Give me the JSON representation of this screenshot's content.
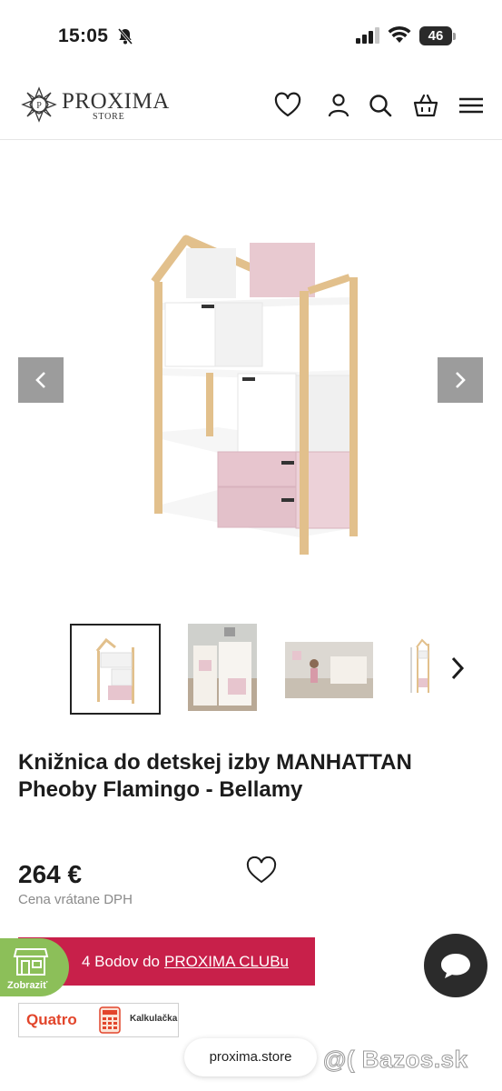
{
  "status_bar": {
    "time": "15:05",
    "battery": "46",
    "icons": [
      "bell-slash-icon",
      "signal-icon",
      "wifi-icon",
      "battery-icon"
    ]
  },
  "header": {
    "logo_name": "PROXIMA",
    "logo_sub": "STORE",
    "icons": [
      "heart-icon",
      "user-icon",
      "search-icon",
      "basket-icon",
      "menu-icon"
    ]
  },
  "gallery": {
    "main_image": "bookshelf-house",
    "thumbnails": [
      "bookshelf-front",
      "bookshelf-room",
      "kids-room-scene",
      "bookshelf-dimensions"
    ],
    "active_thumbnail": 0
  },
  "product": {
    "title": "Knižnica do detskej izby MANHATTAN Pheoby Flamingo - Bellamy",
    "price": "264 €",
    "price_note": "Cena vrátane DPH"
  },
  "club": {
    "prefix": "4 Bodov do",
    "link": "PROXIMA CLUBu"
  },
  "show_badge": {
    "label": "Zobraziť"
  },
  "quatro": {
    "brand": "Quatro",
    "calc_label": "Kalkulačka"
  },
  "browser": {
    "url": "proxima.store"
  },
  "watermark": "@( Bazos.sk",
  "colors": {
    "club_bg": "#c8204a",
    "badge_bg": "#8cbf59",
    "arrow_bg": "#9c9c9c",
    "quatro_red": "#e2452b"
  }
}
